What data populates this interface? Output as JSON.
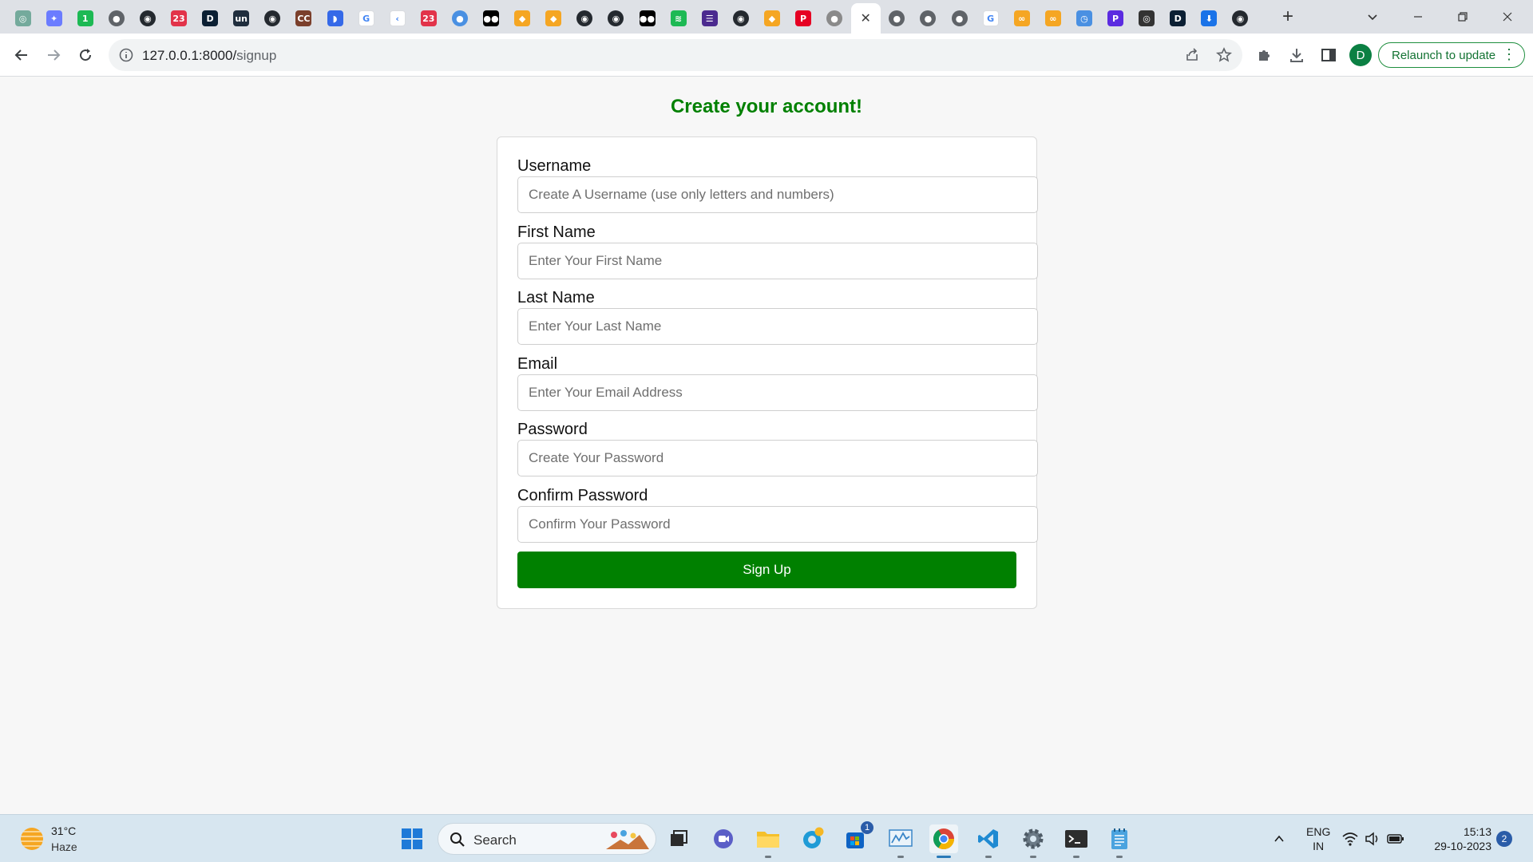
{
  "browser": {
    "url_host": "127.0.0.1:8000/",
    "url_path": "signup",
    "relaunch_label": "Relaunch to update",
    "profile_initial": "D",
    "tabs": [
      {
        "icon": "chatgpt-icon",
        "color": "#74aa9c",
        "glyph": "◎"
      },
      {
        "icon": "gemini-icon",
        "color": "#6b7cff",
        "glyph": "✦"
      },
      {
        "icon": "one-icon",
        "color": "#1db954",
        "glyph": "1"
      },
      {
        "icon": "globe-icon",
        "color": "#5f6368",
        "glyph": "●"
      },
      {
        "icon": "github-icon",
        "color": "#24292f",
        "glyph": "◉"
      },
      {
        "icon": "calendar-icon",
        "color": "#e2334a",
        "glyph": "23"
      },
      {
        "icon": "d-icon",
        "color": "#0b1f33",
        "glyph": "D"
      },
      {
        "icon": "un-icon",
        "color": "#1f2d3d",
        "glyph": "un"
      },
      {
        "icon": "github-icon",
        "color": "#24292f",
        "glyph": "◉"
      },
      {
        "icon": "cc-icon",
        "color": "#7b3f2b",
        "glyph": "CC"
      },
      {
        "icon": "blue-d-icon",
        "color": "#3569e8",
        "glyph": "◗"
      },
      {
        "icon": "google-icon",
        "color": "#ffffff",
        "glyph": "G"
      },
      {
        "icon": "quill-icon",
        "color": "#ffffff",
        "glyph": "‹"
      },
      {
        "icon": "calendar-icon",
        "color": "#e2334a",
        "glyph": "23"
      },
      {
        "icon": "globe-icon",
        "color": "#4a90e2",
        "glyph": "●"
      },
      {
        "icon": "medium-icon",
        "color": "#000000",
        "glyph": "●●"
      },
      {
        "icon": "flame-icon",
        "color": "#f5a623",
        "glyph": "◆"
      },
      {
        "icon": "flame-icon",
        "color": "#f5a623",
        "glyph": "◆"
      },
      {
        "icon": "github-icon",
        "color": "#24292f",
        "glyph": "◉"
      },
      {
        "icon": "github-icon",
        "color": "#24292f",
        "glyph": "◉"
      },
      {
        "icon": "medium-icon",
        "color": "#000000",
        "glyph": "●●"
      },
      {
        "icon": "spotify-icon",
        "color": "#1db954",
        "glyph": "≋"
      },
      {
        "icon": "list-icon",
        "color": "#4b2a8f",
        "glyph": "☰"
      },
      {
        "icon": "github-icon",
        "color": "#24292f",
        "glyph": "◉"
      },
      {
        "icon": "flame-icon",
        "color": "#f5a623",
        "glyph": "◆"
      },
      {
        "icon": "pinterest-icon",
        "color": "#e60023",
        "glyph": "P"
      },
      {
        "icon": "globe-icon",
        "color": "#8a8a8a",
        "glyph": "●"
      },
      {
        "icon": "active-tab-close-icon",
        "color": "#ffffff",
        "glyph": "✕",
        "active": true
      },
      {
        "icon": "globe-icon",
        "color": "#5f6368",
        "glyph": "●"
      },
      {
        "icon": "globe-icon",
        "color": "#5f6368",
        "glyph": "●"
      },
      {
        "icon": "globe-icon",
        "color": "#5f6368",
        "glyph": "●"
      },
      {
        "icon": "google-icon",
        "color": "#ffffff",
        "glyph": "G"
      },
      {
        "icon": "infinity-icon",
        "color": "#f5a623",
        "glyph": "∞"
      },
      {
        "icon": "infinity-icon",
        "color": "#f5a623",
        "glyph": "∞"
      },
      {
        "icon": "history-icon",
        "color": "#4a90e2",
        "glyph": "◷"
      },
      {
        "icon": "p-icon",
        "color": "#5b2be0",
        "glyph": "P"
      },
      {
        "icon": "chrome-icon",
        "color": "#333333",
        "glyph": "◎"
      },
      {
        "icon": "d-icon",
        "color": "#0b1f33",
        "glyph": "D"
      },
      {
        "icon": "download-icon",
        "color": "#1a73e8",
        "glyph": "⬇"
      },
      {
        "icon": "github-icon",
        "color": "#24292f",
        "glyph": "◉"
      }
    ]
  },
  "page": {
    "title": "Create your account!",
    "fields": [
      {
        "label": "Username",
        "placeholder": "Create A Username (use only letters and numbers)",
        "type": "text"
      },
      {
        "label": "First Name",
        "placeholder": "Enter Your First Name",
        "type": "text"
      },
      {
        "label": "Last Name",
        "placeholder": "Enter Your Last Name",
        "type": "text"
      },
      {
        "label": "Email",
        "placeholder": "Enter Your Email Address",
        "type": "email"
      },
      {
        "label": "Password",
        "placeholder": "Create Your Password",
        "type": "password"
      },
      {
        "label": "Confirm Password",
        "placeholder": "Confirm Your Password",
        "type": "password"
      }
    ],
    "submit_label": "Sign Up",
    "accent_color": "#008000"
  },
  "taskbar": {
    "weather_temp": "31°C",
    "weather_desc": "Haze",
    "search_label": "Search",
    "lang_line1": "ENG",
    "lang_line2": "IN",
    "time": "15:13",
    "date": "29-10-2023",
    "notification_count": "2",
    "store_badge": "1"
  }
}
